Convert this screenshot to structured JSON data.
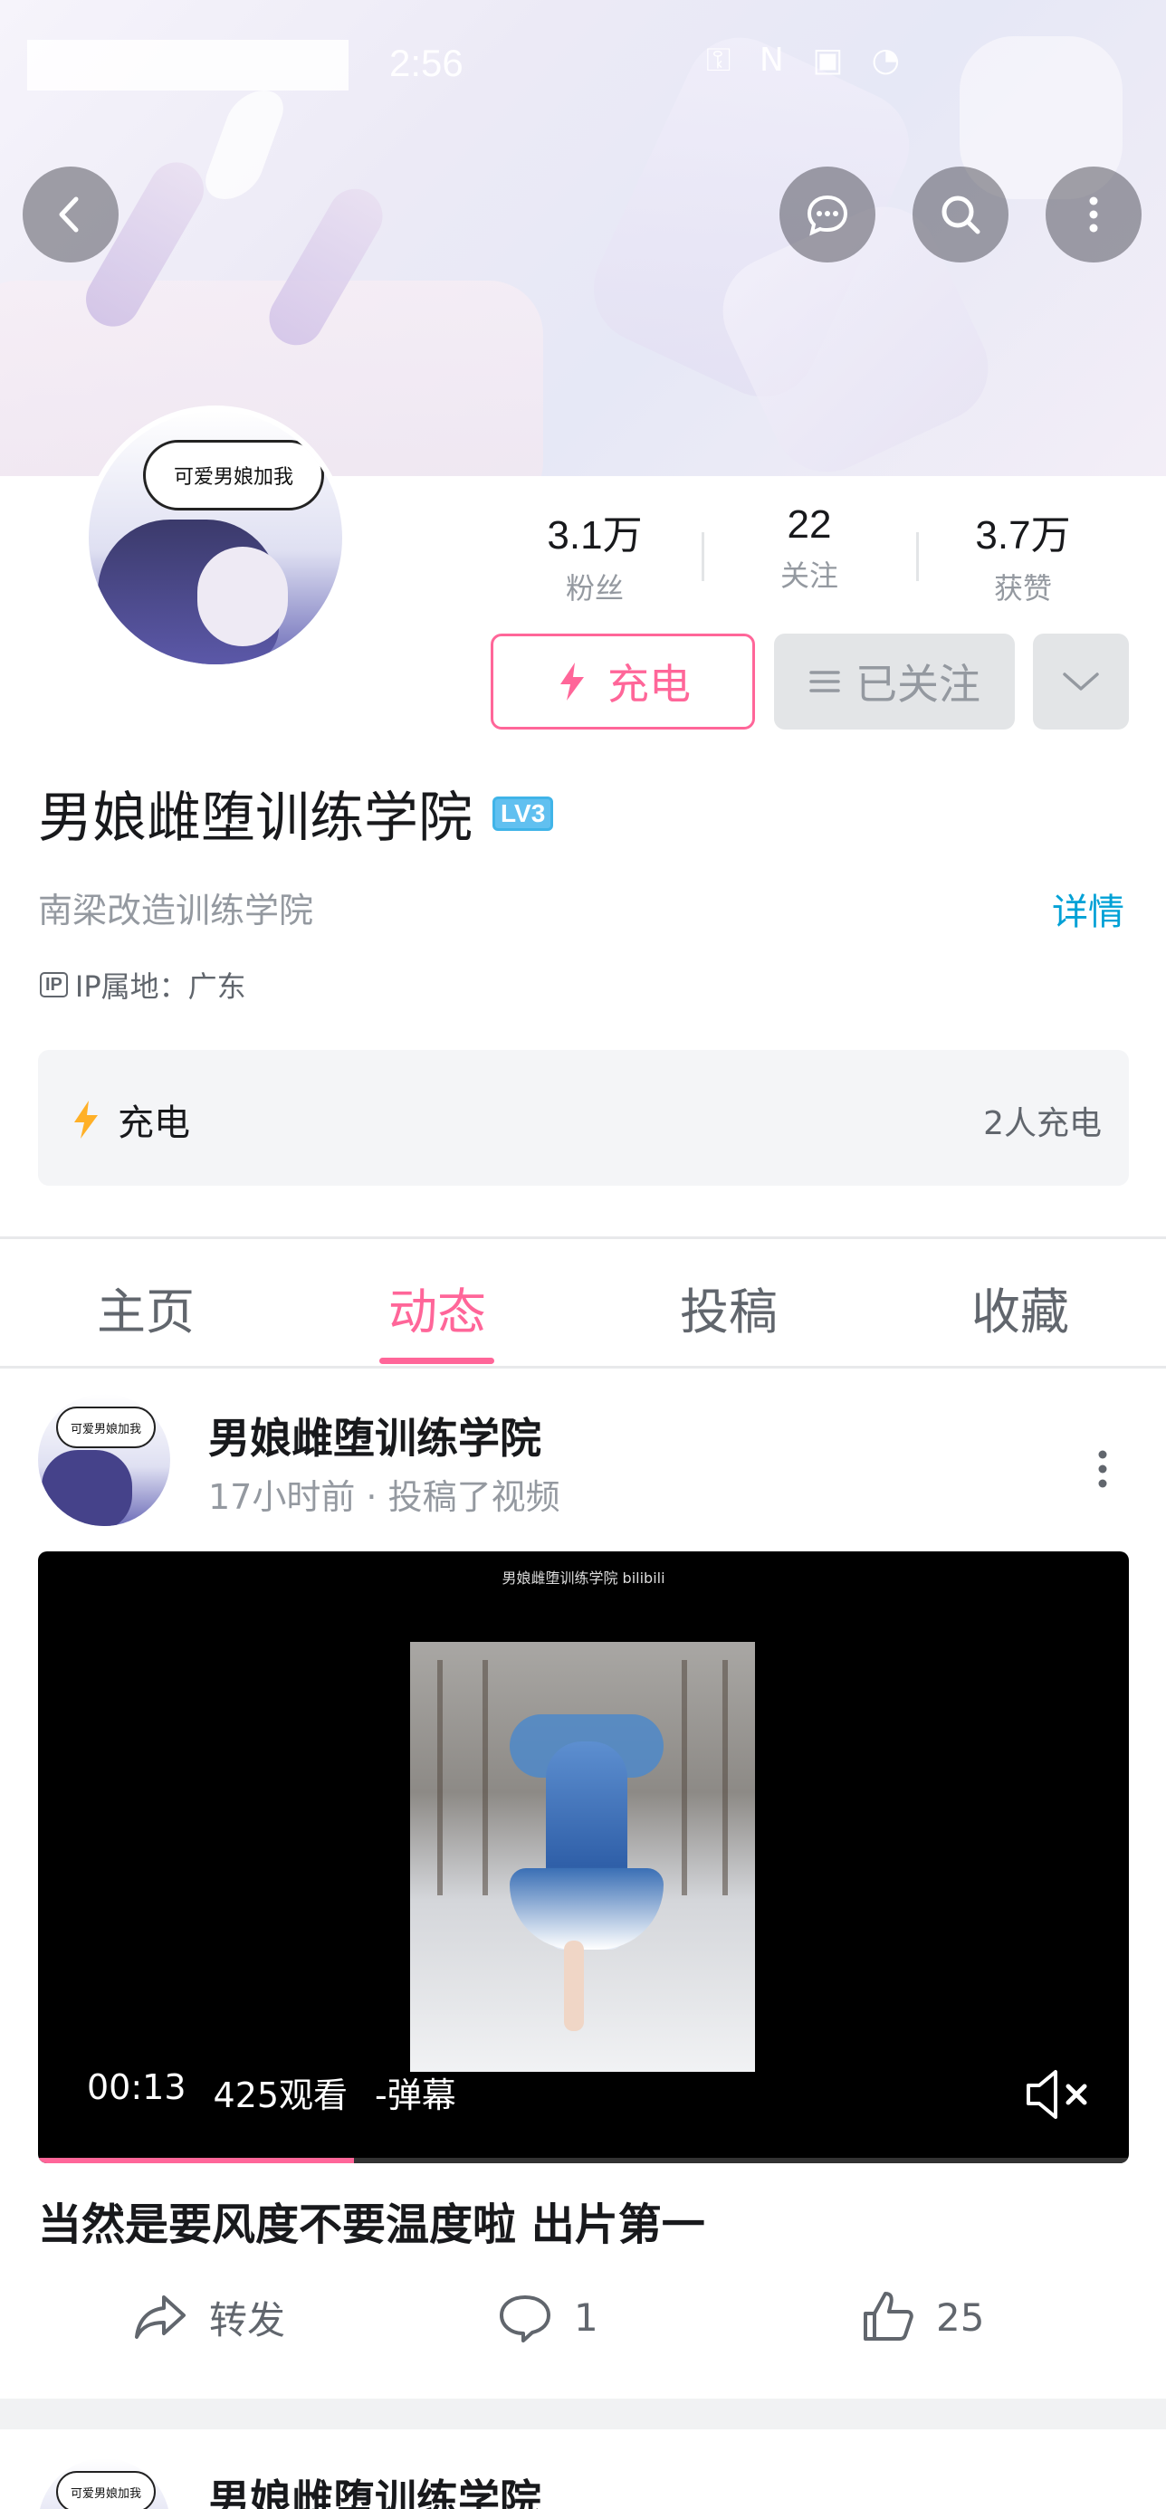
{
  "status_bar": {
    "time": "2:56",
    "icons": "⚿ N ▣ ◔"
  },
  "header": {
    "back": "back-arrow-icon",
    "message": "chat-bubble-icon",
    "search": "search-icon",
    "more": "more-vertical-icon"
  },
  "avatar": {
    "bubble_text": "可爱男娘加我"
  },
  "stats": [
    {
      "value": "3.1万",
      "label": "粉丝"
    },
    {
      "value": "22",
      "label": "关注"
    },
    {
      "value": "3.7万",
      "label": "获赞"
    }
  ],
  "buttons": {
    "charge": "充电",
    "followed": "已关注"
  },
  "profile": {
    "name": "男娘雌堕训练学院",
    "level": "LV3",
    "signature": "南梁改造训练学院",
    "details": "详情",
    "ip": "IP属地：广东",
    "ip_badge": "IP"
  },
  "charge_card": {
    "label": "充电",
    "count": "2人充电"
  },
  "tabs": [
    {
      "label": "主页"
    },
    {
      "label": "动态"
    },
    {
      "label": "投稿"
    },
    {
      "label": "收藏"
    }
  ],
  "active_tab": 1,
  "post": {
    "author": "男娘雌堕训练学院",
    "meta": "17小时前 · 投稿了视频",
    "avatar_bubble": "可爱男娘加我",
    "video": {
      "watermark": "男娘雌堕训练学院 bilibili",
      "duration": "00:13",
      "views": "425观看",
      "danmaku": "-弹幕",
      "progress": 0.29
    },
    "title": "当然是要风度不要温度啦 出片第一",
    "actions": {
      "share": "转发",
      "comments": "1",
      "likes": "25"
    }
  },
  "next_post": {
    "author": "男娘雌堕训练学院",
    "avatar_bubble": "可爱男娘加我"
  },
  "colors": {
    "accent": "#ff6699",
    "link": "#00a1d6",
    "lv": "#61c0f0"
  }
}
